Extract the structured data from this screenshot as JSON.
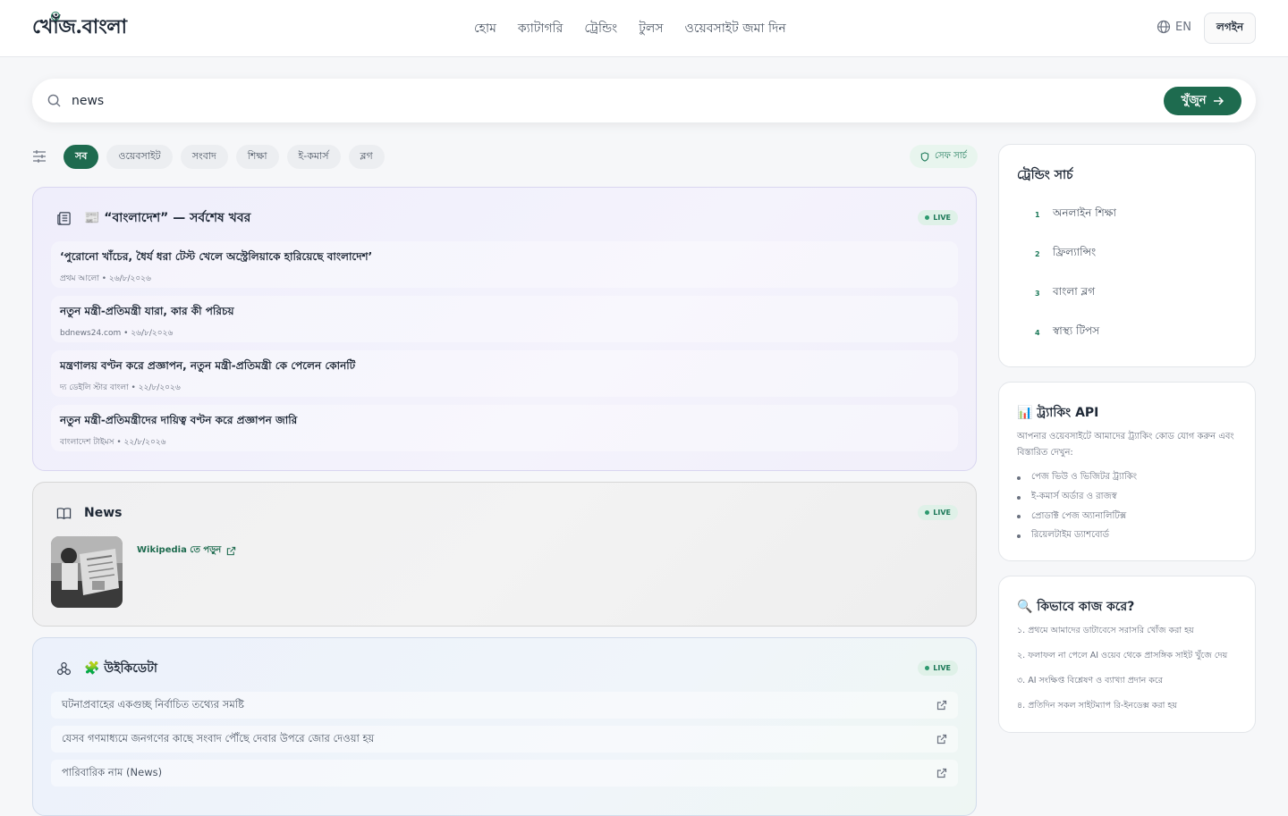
{
  "header": {
    "logo": "খোঁজ.বাংলা",
    "nav": [
      "হোম",
      "ক্যাটাগরি",
      "ট্রেন্ডিং",
      "টুলস",
      "ওয়েবসাইট জমা দিন"
    ],
    "lang": "EN",
    "login": "লগইন"
  },
  "search": {
    "value": "news",
    "button": "খুঁজুন"
  },
  "filters": {
    "chips": [
      "সব",
      "ওয়েবসাইট",
      "সংবাদ",
      "শিক্ষা",
      "ই-কমার্স",
      "ব্লগ"
    ],
    "safe_search": "সেফ সার্চ"
  },
  "news_card": {
    "title": "📰 “বাংলাদেশ” — সর্বশেষ খবর",
    "badge": "LIVE",
    "items": [
      {
        "title": "‘পুরোনো খাঁচের, ধৈর্য ধরা টেস্ট খেলে অস্ট্রেলিয়াকে হারিয়েছে বাংলাদেশ’",
        "meta": "প্রথম আলো • ২৬/৮/২০২৬"
      },
      {
        "title": "নতুন মন্ত্রী-প্রতিমন্ত্রী যারা, কার কী পরিচয়",
        "meta": "bdnews24.com • ২৬/৮/২০২৬"
      },
      {
        "title": "মন্ত্রণালয় বণ্টন করে প্রজ্ঞাপন, নতুন মন্ত্রী-প্রতিমন্ত্রী কে পেলেন কোনটি",
        "meta": "দ্য ডেইলি স্টার বাংলা • ২২/৮/২০২৬"
      },
      {
        "title": "নতুন মন্ত্রী-প্রতিমন্ত্রীদের দায়িত্ব বণ্টন করে প্রজ্ঞাপন জারি",
        "meta": "বাংলাদেশ টাইমস • ২২/৮/২০২৬"
      }
    ]
  },
  "wiki_card": {
    "title": "News",
    "badge": "LIVE",
    "link": "Wikipedia তে পড়ুন"
  },
  "wikidata_card": {
    "title": "🧩 উইকিডেটা",
    "badge": "LIVE",
    "rows": [
      "ঘটনাপ্রবাহের একগুচ্ছ নির্বাচিত তথ্যের সমষ্টি",
      "যেসব গণমাধ্যমে জনগণের কাছে সংবাদ পৌঁছে দেবার উপরে জোর দেওয়া হয়",
      "পারিবারিক নাম (News)"
    ]
  },
  "trending": {
    "title": "ট্রেন্ডিং সার্চ",
    "items": [
      {
        "num": "1",
        "label": "অনলাইন শিক্ষা"
      },
      {
        "num": "2",
        "label": "ফ্রিল্যান্সিং"
      },
      {
        "num": "3",
        "label": "বাংলা ব্লগ"
      },
      {
        "num": "4",
        "label": "স্বাস্থ্য টিপস"
      }
    ]
  },
  "tracking_api": {
    "title": "📊 ট্র্যাকিং API",
    "desc": "আপনার ওয়েবসাইটে আমাদের ট্র্যাকিং কোড যোগ করুন এবং বিস্তারিত দেখুন:",
    "list": [
      "পেজ ভিউ ও ভিজিটর ট্র্যাকিং",
      "ই-কমার্স অর্ডার ও রাজস্ব",
      "প্রোডাক্ট পেজ অ্যানালিটিক্স",
      "রিয়েলটাইম ড্যাশবোর্ড"
    ]
  },
  "how_it_works": {
    "title": "🔍 কিভাবে কাজ করে?",
    "steps": [
      "১. প্রথমে আমাদের ডাটাবেসে সরাসরি খোঁজ করা হয়",
      "২. ফলাফল না পেলে AI ওয়েব থেকে প্রাসঙ্গিক সাইট খুঁজে দেয়",
      "৩. AI সংক্ষিপ্ত বিশ্লেষণ ও ব্যাখ্যা প্রদান করে",
      "৪. প্রতিদিন সকল সাইটম্যাপ রি-ইনডেক্স করা হয়"
    ]
  },
  "colors": {
    "accent": "#1e6b4f",
    "live": "#2d9a6f"
  }
}
